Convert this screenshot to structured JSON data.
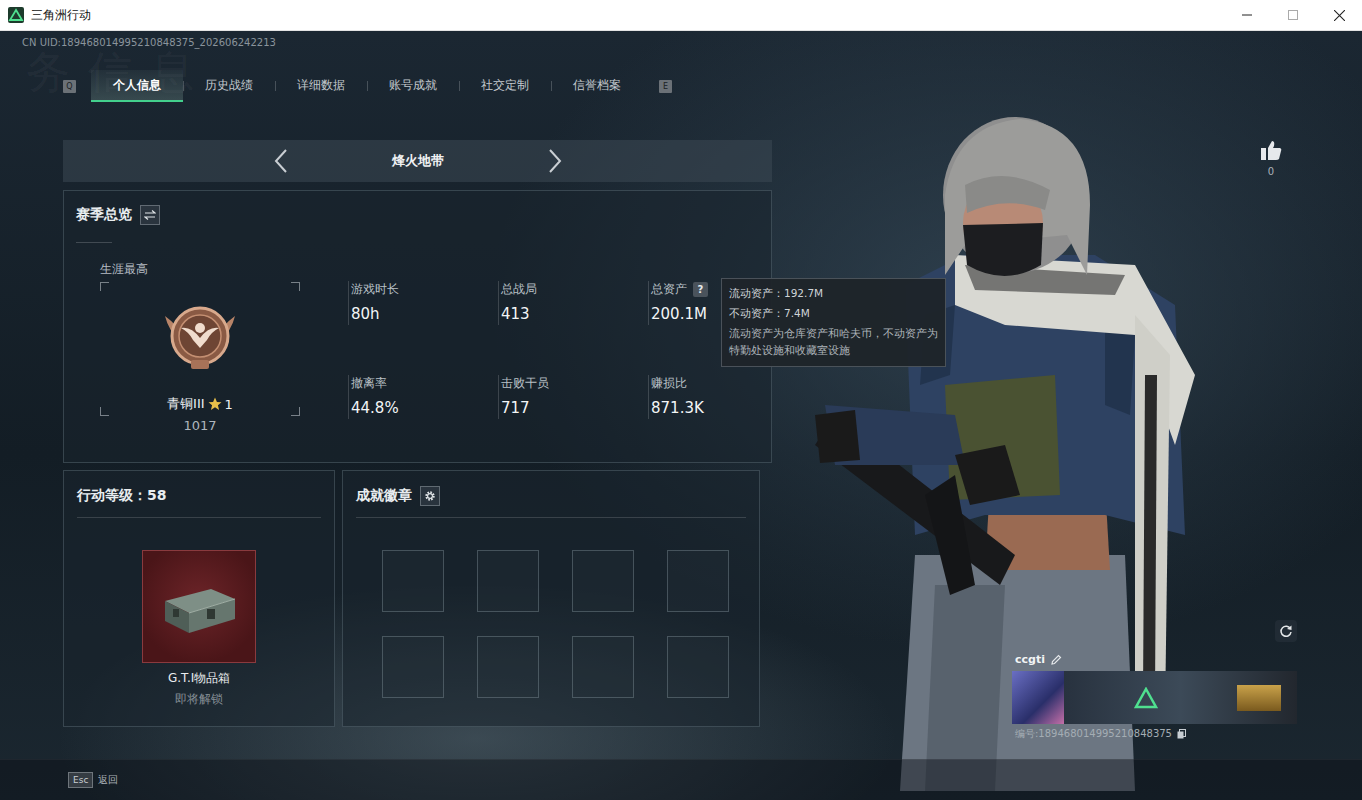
{
  "window": {
    "title": "三角洲行动"
  },
  "uid": "CN UID:189468014995210848375_202606242213",
  "watermark": "务信息",
  "tabs": {
    "prev_key": "Q",
    "next_key": "E",
    "items": [
      {
        "label": "个人信息",
        "selected": true
      },
      {
        "label": "历史战绩",
        "selected": false
      },
      {
        "label": "详细数据",
        "selected": false
      },
      {
        "label": "账号成就",
        "selected": false
      },
      {
        "label": "社交定制",
        "selected": false
      },
      {
        "label": "信誉档案",
        "selected": false
      }
    ]
  },
  "mode": {
    "label": "烽火地带"
  },
  "season": {
    "title": "赛季总览",
    "career": {
      "label": "生涯最高",
      "rank": "青铜III",
      "star_level": "1",
      "score": "1017"
    },
    "stats": [
      {
        "label": "游戏时长",
        "value": "80h"
      },
      {
        "label": "总战局",
        "value": "413"
      },
      {
        "label": "总资产",
        "value": "200.1M",
        "help": "?"
      },
      {
        "label": "撤离率",
        "value": "44.8%"
      },
      {
        "label": "击败干员",
        "value": "717"
      },
      {
        "label": "赚损比",
        "value": "871.3K"
      }
    ],
    "tooltip": {
      "lines": [
        "流动资产：192.7M",
        "不动资产：7.4M"
      ],
      "note": "流动资产为仓库资产和哈夫币，不动资产为特勤处设施和收藏室设施"
    }
  },
  "level": {
    "title": "行动等级：58",
    "reward": {
      "name": "G.T.I物品箱",
      "status": "即将解锁",
      "unlocked": false
    }
  },
  "achievements": {
    "title": "成就徽章",
    "slots": [
      {
        "empty": true
      },
      {
        "empty": true
      },
      {
        "empty": true
      },
      {
        "empty": true
      },
      {
        "empty": true
      },
      {
        "empty": true
      },
      {
        "empty": true
      },
      {
        "empty": true
      }
    ]
  },
  "likes": {
    "count": "0"
  },
  "profile": {
    "name": "ccgti",
    "id": "编号:189468014995210848375"
  },
  "footer": {
    "key": "Esc",
    "label": "返回"
  }
}
